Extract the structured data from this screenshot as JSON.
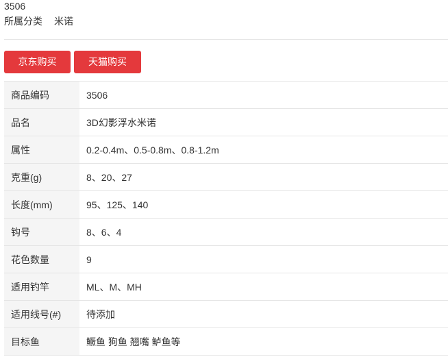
{
  "product": {
    "code": "3506",
    "category_label": "所属分类",
    "category_value": "米诺"
  },
  "buttons": {
    "jd": "京东购买",
    "tmall": "天猫购买"
  },
  "colors": {
    "button_red": "#e4393c",
    "label_bg": "#f5f5f5",
    "border": "#e5e5e5"
  },
  "specs": [
    {
      "label": "商品编码",
      "value": "3506"
    },
    {
      "label": "品名",
      "value": "3D幻影浮水米诺"
    },
    {
      "label": "属性",
      "value": "0.2-0.4m、0.5-0.8m、0.8-1.2m"
    },
    {
      "label": "克重(g)",
      "value": "8、20、27"
    },
    {
      "label": "长度(mm)",
      "value": "95、125、140"
    },
    {
      "label": "钩号",
      "value": "8、6、4"
    },
    {
      "label": "花色数量",
      "value": "9"
    },
    {
      "label": "适用钓竿",
      "value": "ML、M、MH"
    },
    {
      "label": "适用线号(#)",
      "value": "待添加"
    },
    {
      "label": "目标鱼",
      "value": "鳜鱼 狗鱼 翘嘴 鲈鱼等"
    }
  ]
}
